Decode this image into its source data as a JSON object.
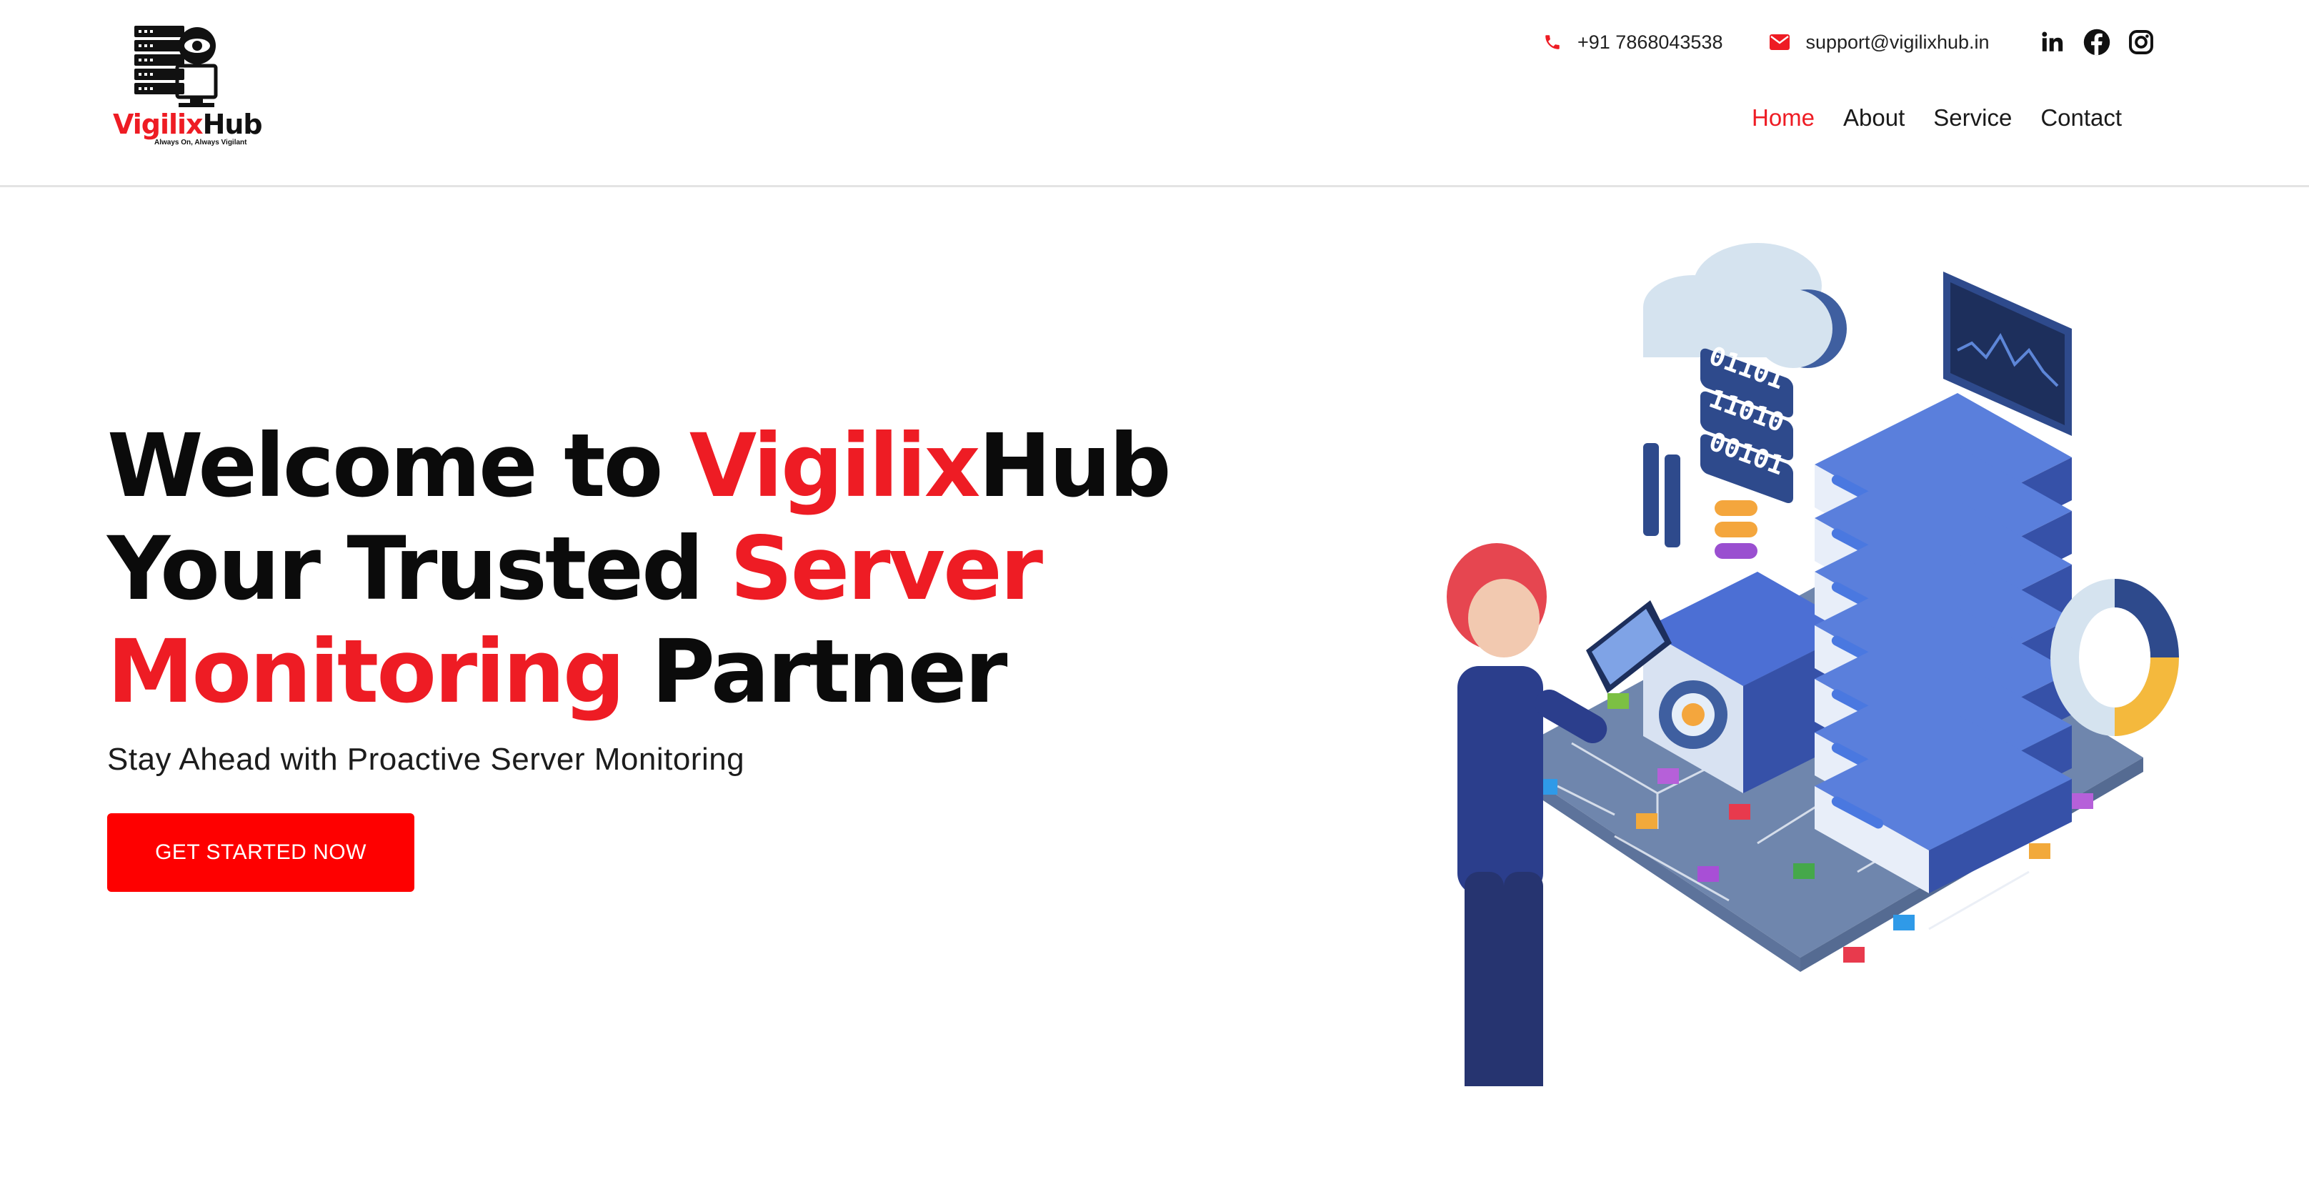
{
  "brand": {
    "name_part1": "Vigilix",
    "name_part2": "Hub",
    "tagline": "Always On, Always Vigilant"
  },
  "contact": {
    "phone": "+91 7868043538",
    "email": "support@vigilixhub.in"
  },
  "socials": [
    "linkedin-icon",
    "facebook-icon",
    "instagram-icon"
  ],
  "nav": {
    "items": [
      {
        "label": "Home",
        "active": true
      },
      {
        "label": "About",
        "active": false
      },
      {
        "label": "Service",
        "active": false
      },
      {
        "label": "Contact",
        "active": false
      }
    ]
  },
  "hero": {
    "line1_a": "Welcome to ",
    "line1_b": "Vigilix",
    "line1_c": "Hub",
    "line2_a": "Your Trusted ",
    "line2_b": "Server",
    "line3_a": "Monitoring",
    "line3_b": " Partner",
    "subtitle": "Stay Ahead with Proactive Server Monitoring",
    "cta_label": "GET STARTED NOW"
  },
  "illustration": {
    "binary_rows": [
      "01101",
      "11010",
      "00101"
    ]
  },
  "colors": {
    "accent": "#ee1c24",
    "button": "#fe0000",
    "server_blue": "#3f5fc6",
    "text_dark": "#0b0b0b"
  }
}
